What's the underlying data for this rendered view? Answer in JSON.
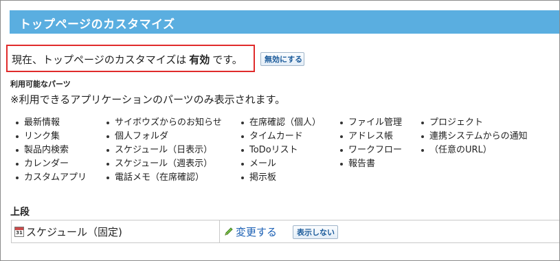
{
  "header": {
    "title": "トップページのカスタマイズ"
  },
  "status": {
    "prefix": "現在、トップページのカスタマイズは",
    "state": "有効",
    "suffix": "です。",
    "disable_button": "無効にする"
  },
  "parts": {
    "heading": "利用可能なパーツ",
    "note": "※利用できるアプリケーションのパーツのみ表示されます。",
    "columns": [
      [
        "最新情報",
        "リンク集",
        "製品内検索",
        "カレンダー",
        "カスタムアプリ"
      ],
      [
        "サイボウズからのお知らせ",
        "個人フォルダ",
        "スケジュール（日表示）",
        "スケジュール（週表示）",
        "電話メモ（在席確認）"
      ],
      [
        "在席確認（個人）",
        "タイムカード",
        "ToDoリスト",
        "メール",
        "掲示板"
      ],
      [
        "ファイル管理",
        "アドレス帳",
        "ワークフロー",
        "報告書"
      ],
      [
        "プロジェクト",
        "連携システムからの通知",
        "（任意のURL）"
      ]
    ]
  },
  "section": {
    "title": "上段",
    "rows": [
      {
        "icon_day": "31",
        "label": "スケジュール（固定)",
        "change_link": "変更する",
        "hide_button": "表示しない"
      }
    ]
  },
  "colors": {
    "header_bar": "#5aaee0",
    "highlight_border": "#e02a2a",
    "link": "#1a5fb4"
  },
  "icons": {
    "calendar": "calendar-icon",
    "pencil": "pencil-icon"
  }
}
